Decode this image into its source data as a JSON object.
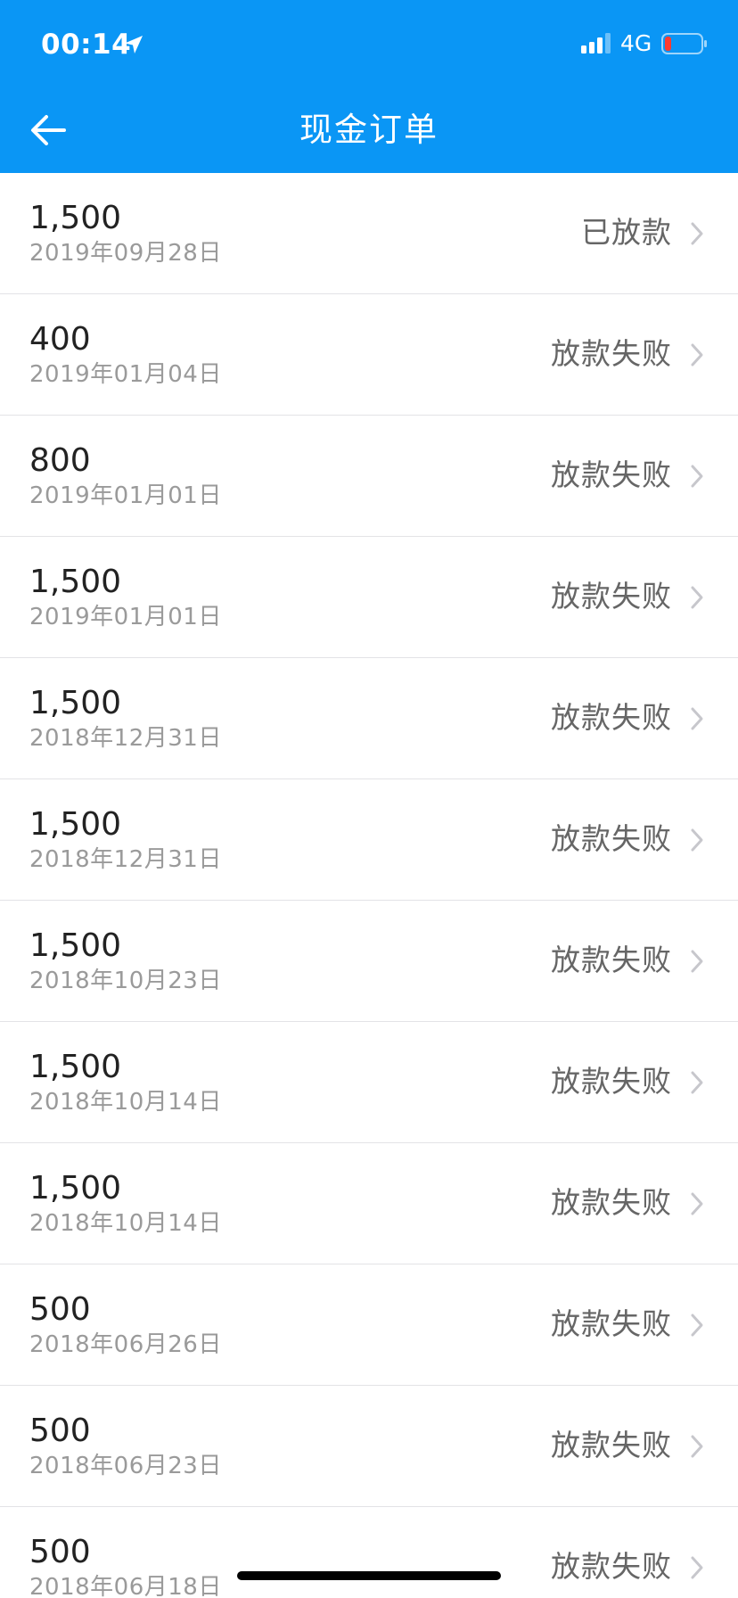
{
  "status_bar": {
    "time": "00:14",
    "network": "4G",
    "location_icon": "location-arrow-icon",
    "signal_icon": "signal-bars-icon",
    "battery_icon": "battery-low-icon",
    "battery_color": "#ff3b30"
  },
  "header": {
    "title": "现金订单",
    "back_icon": "back-arrow-icon",
    "background": "#0a96f5"
  },
  "orders": [
    {
      "amount": "1,500",
      "date": "2019年09月28日",
      "status": "已放款"
    },
    {
      "amount": "400",
      "date": "2019年01月04日",
      "status": "放款失败"
    },
    {
      "amount": "800",
      "date": "2019年01月01日",
      "status": "放款失败"
    },
    {
      "amount": "1,500",
      "date": "2019年01月01日",
      "status": "放款失败"
    },
    {
      "amount": "1,500",
      "date": "2018年12月31日",
      "status": "放款失败"
    },
    {
      "amount": "1,500",
      "date": "2018年12月31日",
      "status": "放款失败"
    },
    {
      "amount": "1,500",
      "date": "2018年10月23日",
      "status": "放款失败"
    },
    {
      "amount": "1,500",
      "date": "2018年10月14日",
      "status": "放款失败"
    },
    {
      "amount": "1,500",
      "date": "2018年10月14日",
      "status": "放款失败"
    },
    {
      "amount": "500",
      "date": "2018年06月26日",
      "status": "放款失败"
    },
    {
      "amount": "500",
      "date": "2018年06月23日",
      "status": "放款失败"
    },
    {
      "amount": "500",
      "date": "2018年06月18日",
      "status": "放款失败"
    }
  ],
  "row_icon": "chevron-right-icon"
}
